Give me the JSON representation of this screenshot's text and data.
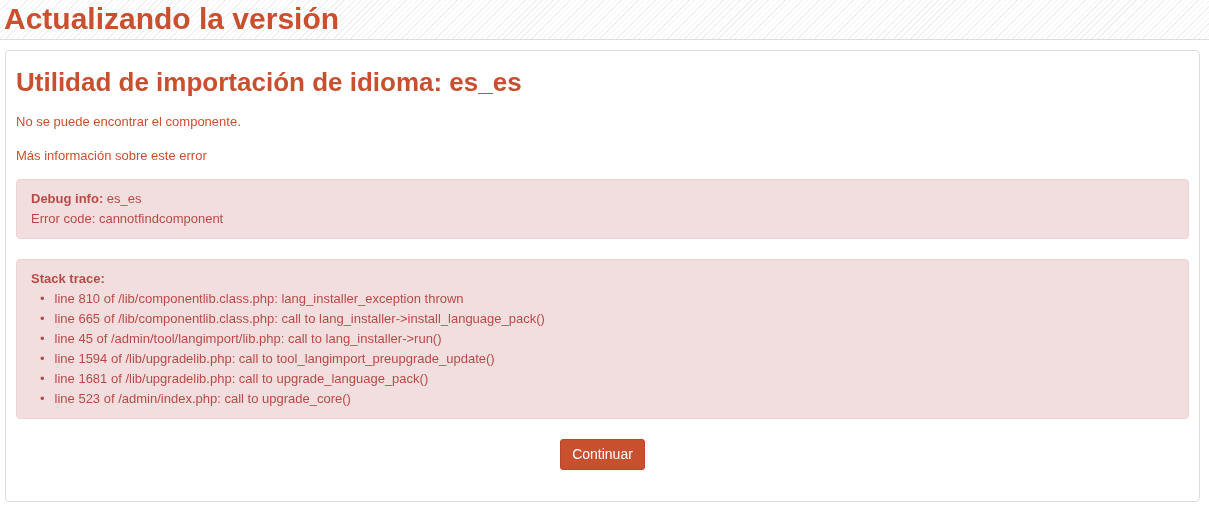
{
  "page_title": "Actualizando la versión",
  "heading": "Utilidad de importación de idioma: es_es",
  "message": "No se puede encontrar el componente.",
  "more_info_link": "Más información sobre este error",
  "debug_box": {
    "debug_info": "**Debug info:** es_es",
    "error_code": "Error code: cannotfindcomponent"
  },
  "stack_trace": {
    "label": "Stack trace:",
    "lines": [
      {
        "bullet": "•",
        "text": "line 810 of /lib/componentlib.class.php: lang_installer_exception thrown"
      },
      {
        "bullet": "•",
        "text": "line 665 of /lib/componentlib.class.php: call to lang_installer->install_language_pack()"
      },
      {
        "bullet": "•",
        "text": "line 45 of /admin/tool/langimport/lib.php: call to lang_installer->run()"
      },
      {
        "bullet": "•",
        "text": "line 1594 of /lib/upgradelib.php: call to tool_langimport_preupgrade_update()"
      },
      {
        "bullet": "•",
        "text": "line 1681 of /lib/upgradelib.php: call to upgrade_language_pack()"
      },
      {
        "bullet": "•",
        "text": "line 523 of /admin/index.php: call to upgrade_core()"
      }
    ]
  },
  "continue_button": "Continuar"
}
